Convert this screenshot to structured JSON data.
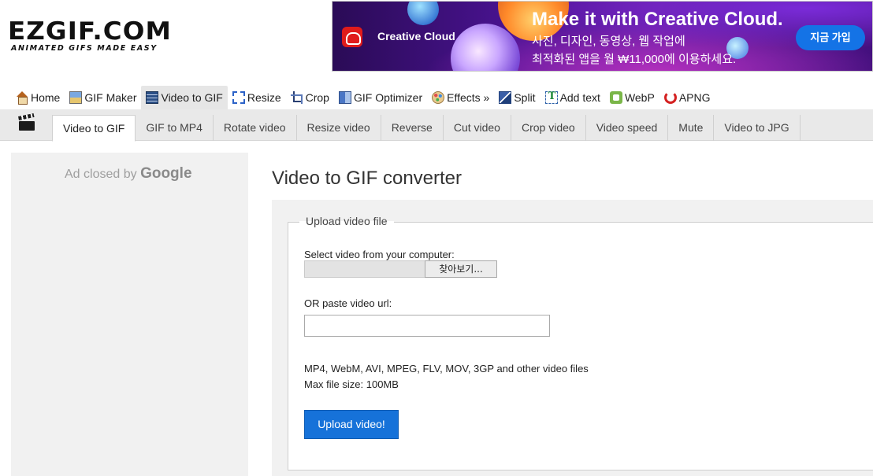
{
  "logo": {
    "name": "EZGIF.COM",
    "tagline": "ANIMATED GIFS MADE EASY"
  },
  "banner": {
    "brand": "Creative Cloud",
    "headline": "Make it with Creative Cloud.",
    "sub_line1": "사진, 디자인, 동영상, 웹 작업에",
    "sub_line2": "최적화된 앱을 월 ₩11,000에 이용하세요.",
    "cta": "지금 가입",
    "accent": "#1473e6"
  },
  "mainnav": {
    "items": [
      {
        "label": "Home",
        "icon": "home-icon"
      },
      {
        "label": "GIF Maker",
        "icon": "gif-maker-icon"
      },
      {
        "label": "Video to GIF",
        "icon": "film-icon",
        "active": true
      },
      {
        "label": "Resize",
        "icon": "resize-icon"
      },
      {
        "label": "Crop",
        "icon": "crop-icon"
      },
      {
        "label": "GIF Optimizer",
        "icon": "optimizer-icon"
      },
      {
        "label": "Effects »",
        "icon": "effects-palette-icon"
      },
      {
        "label": "Split",
        "icon": "split-icon"
      },
      {
        "label": "Add text",
        "icon": "add-text-icon"
      },
      {
        "label": "WebP",
        "icon": "webp-icon"
      },
      {
        "label": "APNG",
        "icon": "apng-icon"
      }
    ]
  },
  "subnav": {
    "icon": "clapperboard-icon",
    "tabs": [
      {
        "label": "Video to GIF",
        "active": true
      },
      {
        "label": "GIF to MP4"
      },
      {
        "label": "Rotate video"
      },
      {
        "label": "Resize video"
      },
      {
        "label": "Reverse"
      },
      {
        "label": "Cut video"
      },
      {
        "label": "Crop video"
      },
      {
        "label": "Video speed"
      },
      {
        "label": "Mute"
      },
      {
        "label": "Video to JPG"
      }
    ]
  },
  "left_ad": {
    "text": "Ad closed by",
    "brand": "Google"
  },
  "main": {
    "title": "Video to GIF converter",
    "form": {
      "legend": "Upload video file",
      "file_label": "Select video from your computer:",
      "browse_label": "찾아보기...",
      "url_label": "OR paste video url:",
      "url_value": "",
      "formats_line1": "MP4, WebM, AVI, MPEG, FLV, MOV, 3GP and other video files",
      "formats_line2": "Max file size: 100MB",
      "upload_label": "Upload video!",
      "upload_color": "#1672d9"
    }
  }
}
